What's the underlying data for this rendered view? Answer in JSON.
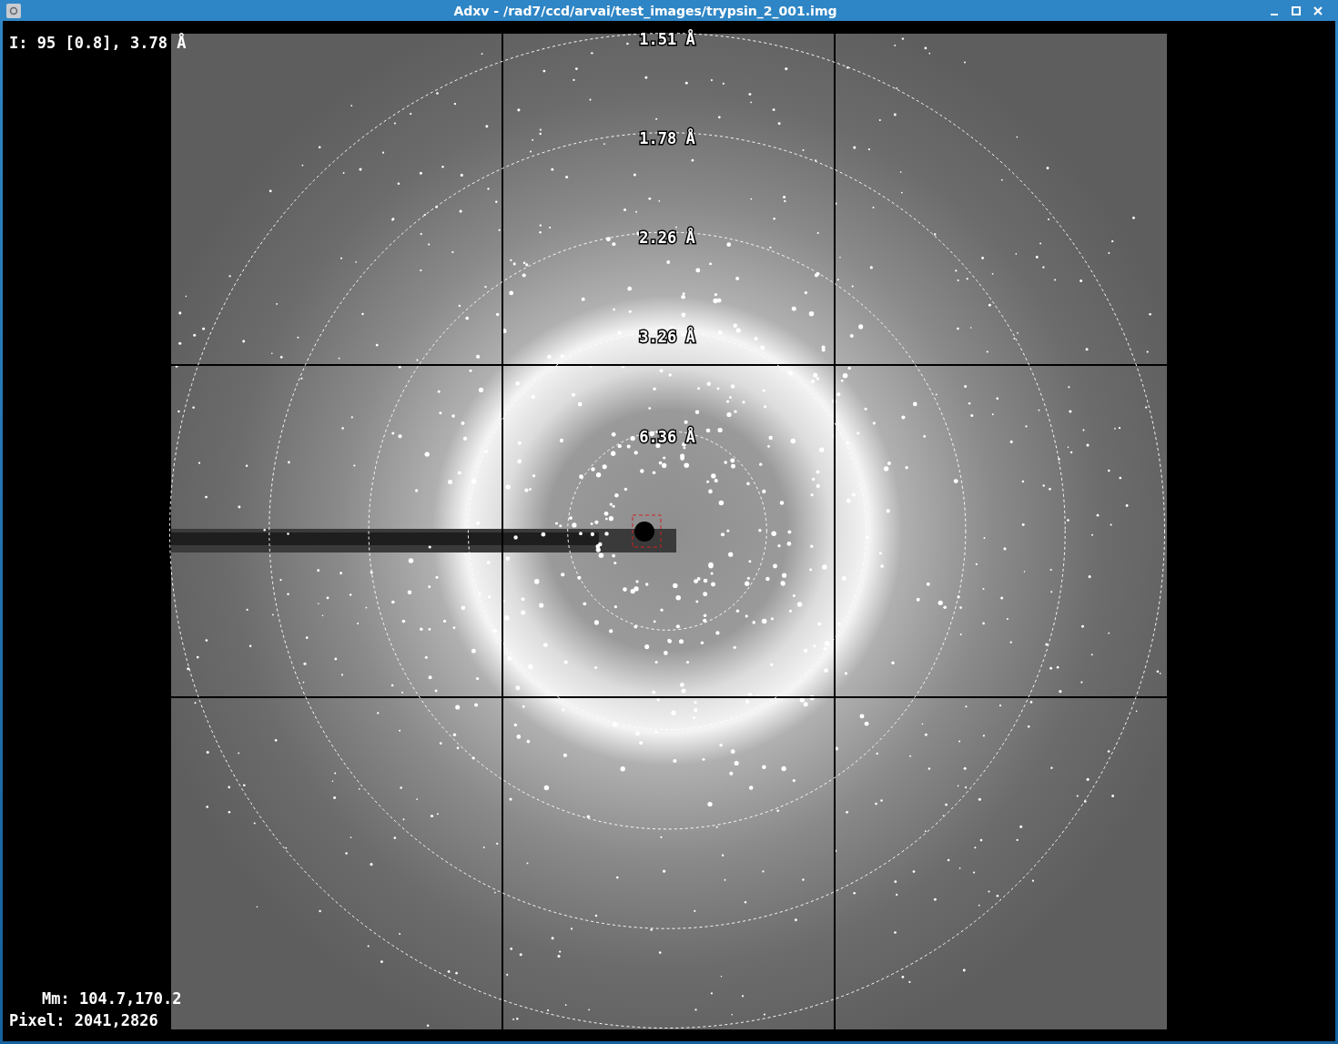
{
  "window": {
    "title": "Adxv - /rad7/ccd/arvai/test_images/trypsin_2_001.img"
  },
  "readouts": {
    "intensity": "I: 95 [0.8], 3.78 Å",
    "mm": "Mm: 104.7,170.2",
    "pixel": "Pixel: 2041,2826"
  },
  "rings": [
    {
      "label": "1.51 Å"
    },
    {
      "label": "1.78 Å"
    },
    {
      "label": "2.26 Å"
    },
    {
      "label": "3.26 Å"
    },
    {
      "label": "6.36 Å"
    }
  ]
}
